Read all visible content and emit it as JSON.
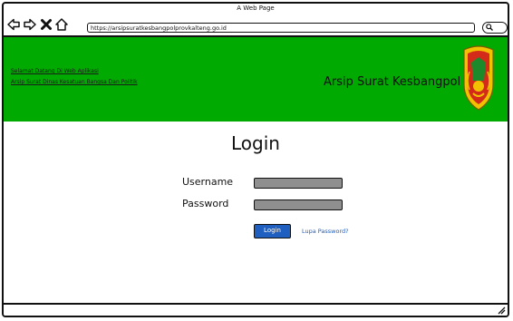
{
  "window": {
    "title": "A Web Page",
    "url": "https://arsipsuratkesbangpolprovkalteng.go.id"
  },
  "toolbar": {
    "back_icon": "back-arrow-icon",
    "forward_icon": "forward-arrow-icon",
    "close_icon": "close-icon",
    "home_icon": "home-icon",
    "search_icon": "search-icon"
  },
  "header": {
    "welcome_line1": "Selamat Datang Di Web Aplikasi",
    "welcome_line2": "Arsip Surat Dinas Kesatuan Bangsa Dan Politik",
    "site_title": "Arsip Surat Kesbangpol",
    "bg_color": "#00aa00"
  },
  "login": {
    "title": "Login",
    "username_label": "Username",
    "password_label": "Password",
    "username_value": "",
    "password_value": "",
    "login_button": "Login",
    "forgot_link": "Lupa Password?",
    "button_color": "#1f5fbf"
  }
}
